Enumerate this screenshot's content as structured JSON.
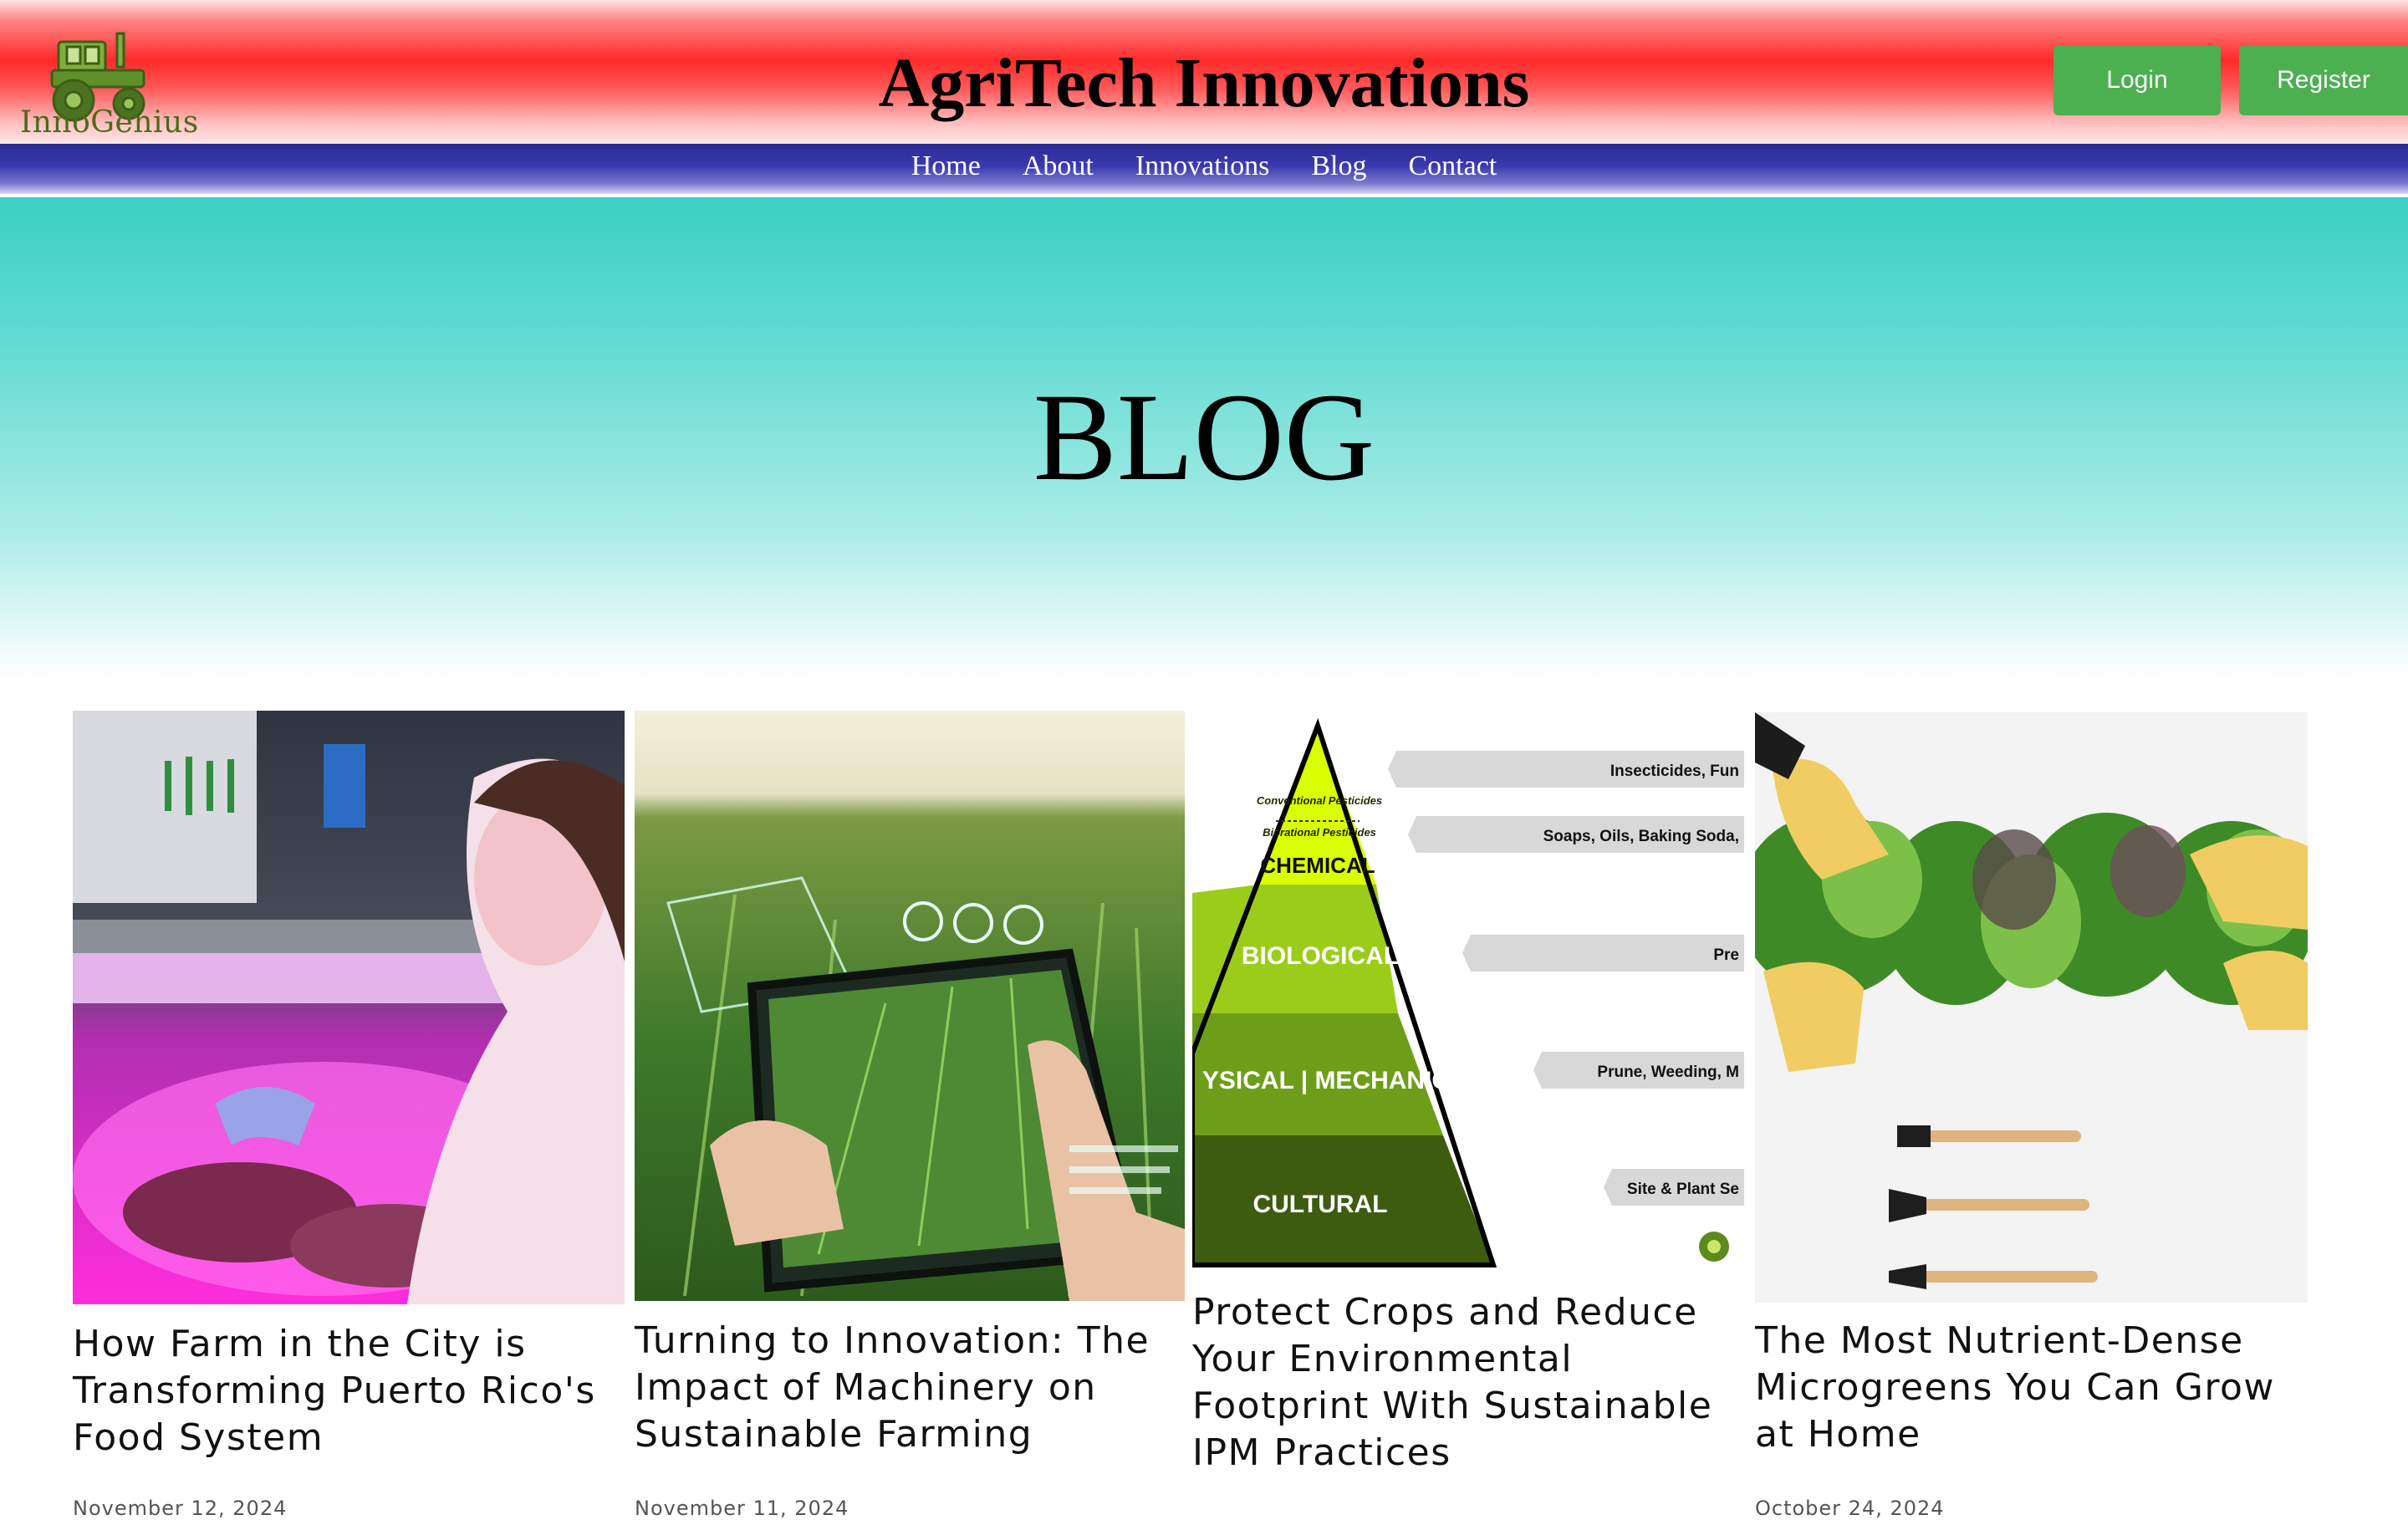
{
  "brand": {
    "logo_text": "InnoGenius"
  },
  "header": {
    "title": "AgriTech Innovations",
    "login_label": "Login",
    "register_label": "Register"
  },
  "nav": {
    "items": [
      "Home",
      "About",
      "Innovations",
      "Blog",
      "Contact"
    ]
  },
  "hero": {
    "title": "BLOG"
  },
  "colors": {
    "accent_button": "#4caf50",
    "nav_bar": "#3a3ab0",
    "header_red": "#ff2a2a",
    "hero_teal": "#3bcfc3"
  },
  "posts": [
    {
      "title": "How Farm in the City is Transforming Puerto Rico's Food System",
      "date": "November 12, 2024",
      "image": "indoor-farming-photo"
    },
    {
      "title": "Turning to Innovation: The Impact of Machinery on Sustainable Farming",
      "date": "November 11, 2024",
      "image": "smart-tablet-field-photo"
    },
    {
      "title": "Protect Crops and Reduce Your Environmental Footprint With Sustainable IPM Practices",
      "date": "",
      "image": "ipm-pyramid-diagram",
      "pyramid": {
        "levels": [
          "CHEMICAL",
          "BIOLOGICAL",
          "YSICAL | MECHANICAL",
          "CULTURAL"
        ],
        "top_notes": [
          "Conventional Pesticides",
          "Biorational Pesticides"
        ],
        "callouts": [
          "Insecticides, Fun",
          "Soaps, Oils, Baking Soda,",
          "Pre",
          "Prune, Weeding, M",
          "Site & Plant Se"
        ]
      }
    },
    {
      "title": "The Most Nutrient-Dense Microgreens You Can Grow at Home",
      "date": "October 24, 2024",
      "image": "microgreens-photo"
    }
  ]
}
